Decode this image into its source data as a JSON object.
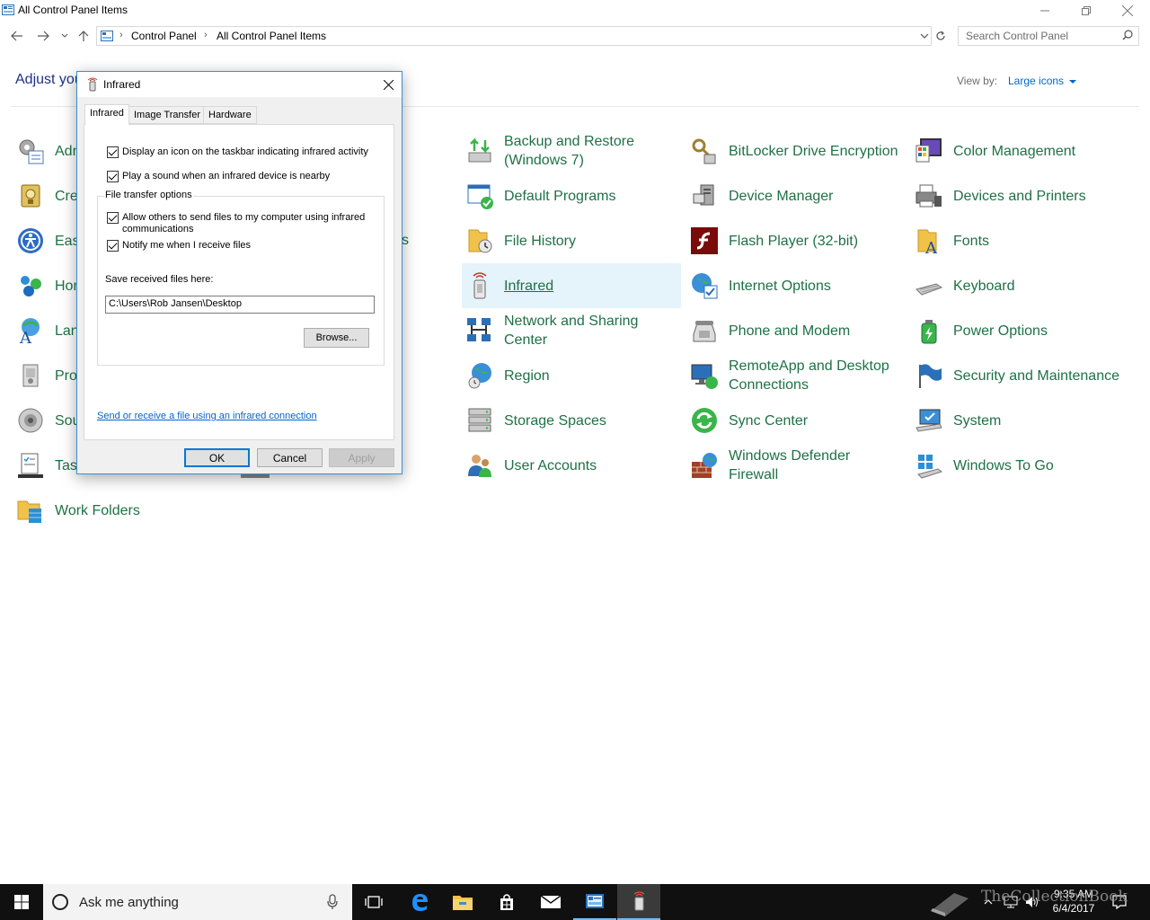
{
  "window": {
    "title": "All Control Panel Items"
  },
  "nav": {
    "breadcrumbs": [
      "Control Panel",
      "All Control Panel Items"
    ],
    "search_placeholder": "Search Control Panel"
  },
  "header": {
    "adjust_text": "Adjust you",
    "view_by_label": "View by:",
    "view_by_value": "Large icons"
  },
  "items": {
    "c1": [
      "Adn",
      "Cre",
      "Eas",
      "Hon",
      "Lan",
      "Pro",
      "Sou",
      "Task",
      "Work Folders"
    ],
    "c2_partial": "s",
    "c3": [
      {
        "l1": "Backup and Restore",
        "l2": "(Windows 7)"
      },
      {
        "l1": "Default Programs",
        "l2": ""
      },
      {
        "l1": "File History",
        "l2": ""
      },
      {
        "l1": "Infrared",
        "l2": ""
      },
      {
        "l1": "Network and Sharing",
        "l2": "Center"
      },
      {
        "l1": "Region",
        "l2": ""
      },
      {
        "l1": "Storage Spaces",
        "l2": ""
      },
      {
        "l1": "User Accounts",
        "l2": ""
      }
    ],
    "c4": [
      {
        "l1": "BitLocker Drive Encryption",
        "l2": ""
      },
      {
        "l1": "Device Manager",
        "l2": ""
      },
      {
        "l1": "Flash Player (32-bit)",
        "l2": ""
      },
      {
        "l1": "Internet Options",
        "l2": ""
      },
      {
        "l1": "Phone and Modem",
        "l2": ""
      },
      {
        "l1": "RemoteApp and Desktop",
        "l2": "Connections"
      },
      {
        "l1": "Sync Center",
        "l2": ""
      },
      {
        "l1": "Windows Defender",
        "l2": "Firewall"
      }
    ],
    "c5": [
      {
        "l1": "Color Management",
        "l2": ""
      },
      {
        "l1": "Devices and Printers",
        "l2": ""
      },
      {
        "l1": "Fonts",
        "l2": ""
      },
      {
        "l1": "Keyboard",
        "l2": ""
      },
      {
        "l1": "Power Options",
        "l2": ""
      },
      {
        "l1": "Security and Maintenance",
        "l2": ""
      },
      {
        "l1": "System",
        "l2": ""
      },
      {
        "l1": "Windows To Go",
        "l2": ""
      }
    ]
  },
  "dialog": {
    "title": "Infrared",
    "tabs": [
      "Infrared",
      "Image Transfer",
      "Hardware"
    ],
    "checks": [
      {
        "label": "Display an icon on the taskbar indicating infrared activity",
        "checked": true
      },
      {
        "label": "Play a sound when an infrared device is nearby",
        "checked": true
      }
    ],
    "group_legend": "File transfer options",
    "group_checks": [
      {
        "l1": "Allow others to send files to my computer using infrared",
        "l2": "communications",
        "checked": true
      },
      {
        "l1": "Notify me when I receive files",
        "l2": "",
        "checked": true
      }
    ],
    "save_label": "Save received files here:",
    "save_path": "C:\\Users\\Rob Jansen\\Desktop",
    "browse": "Browse...",
    "link": "Send or receive a file using an infrared connection",
    "ok": "OK",
    "cancel": "Cancel",
    "apply": "Apply"
  },
  "taskbar": {
    "search_text": "Ask me anything",
    "time": "9:35 AM",
    "date": "6/4/2017",
    "watermark": "TheCollectionBook"
  },
  "colors": {
    "item_text": "#1e7145",
    "link": "#0066cc",
    "header_text": "#1e3287",
    "selected_bg": "#e5f3fb"
  }
}
